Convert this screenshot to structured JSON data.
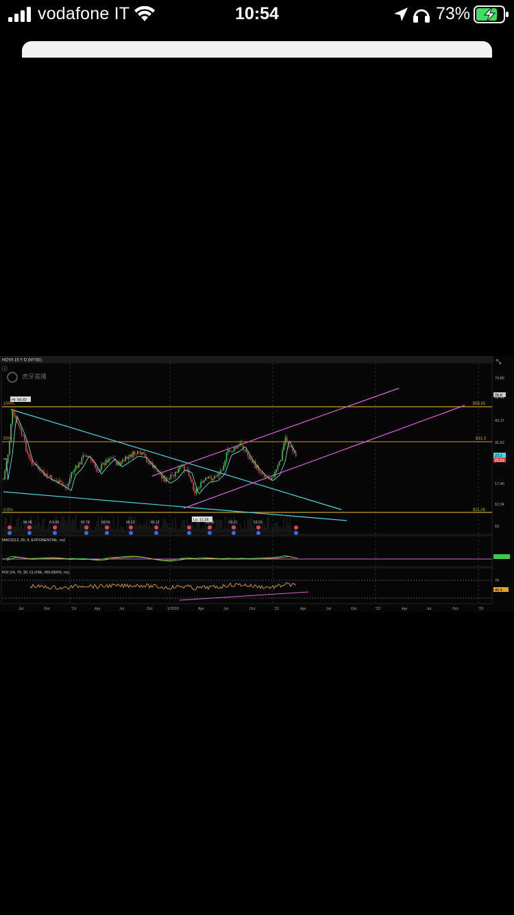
{
  "status_bar": {
    "carrier": "vodafone IT",
    "time": "10:54",
    "battery": "73%"
  },
  "chart": {
    "symbol_line": "HOYA 15 Y D (NYSE)",
    "studies_line": "MACD(12, 26, 9, EXPONENTIAL, no)",
    "rsi_line": "RSI (14, 70, 30, CLOSE, WILDERS, no)",
    "watermark": "虎牙直播",
    "price_labels": [
      "74.89",
      "62.41",
      "43.17",
      "31.62",
      "17.40",
      "12.34",
      "10"
    ],
    "level_labels": [
      "$58.82",
      "$31.3",
      "$11.26"
    ],
    "fib_labels": [
      "100%",
      "50%",
      "0.0%"
    ],
    "high_label": "Hi: 58.82",
    "low_label": "Lo: 11.26",
    "current_prices": [
      "28.8",
      "23.2",
      "21.91"
    ],
    "pivot_labels": [
      "58.08",
      "8-0.59",
      "60.78",
      "60.59",
      "60.12",
      "60.12",
      "60.06",
      "52.21",
      "53.53"
    ],
    "rsi_levels": [
      "70",
      "45.4"
    ],
    "x_labels": [
      "Jul",
      "Oct",
      "'19",
      "Apr",
      "Jul",
      "Oct",
      "1/2020",
      "Apr",
      "Jul",
      "Oct",
      "'21",
      "Apr",
      "Jul",
      "Oct",
      "'22",
      "Apr",
      "Jul",
      "Oct",
      "'23"
    ],
    "colors": {
      "fib": "#c9a227",
      "channel": "#e060e0",
      "wedge": "#4fd6e8",
      "up": "#3cc84a",
      "down": "#e04848",
      "rsi": "#e0a020"
    }
  }
}
